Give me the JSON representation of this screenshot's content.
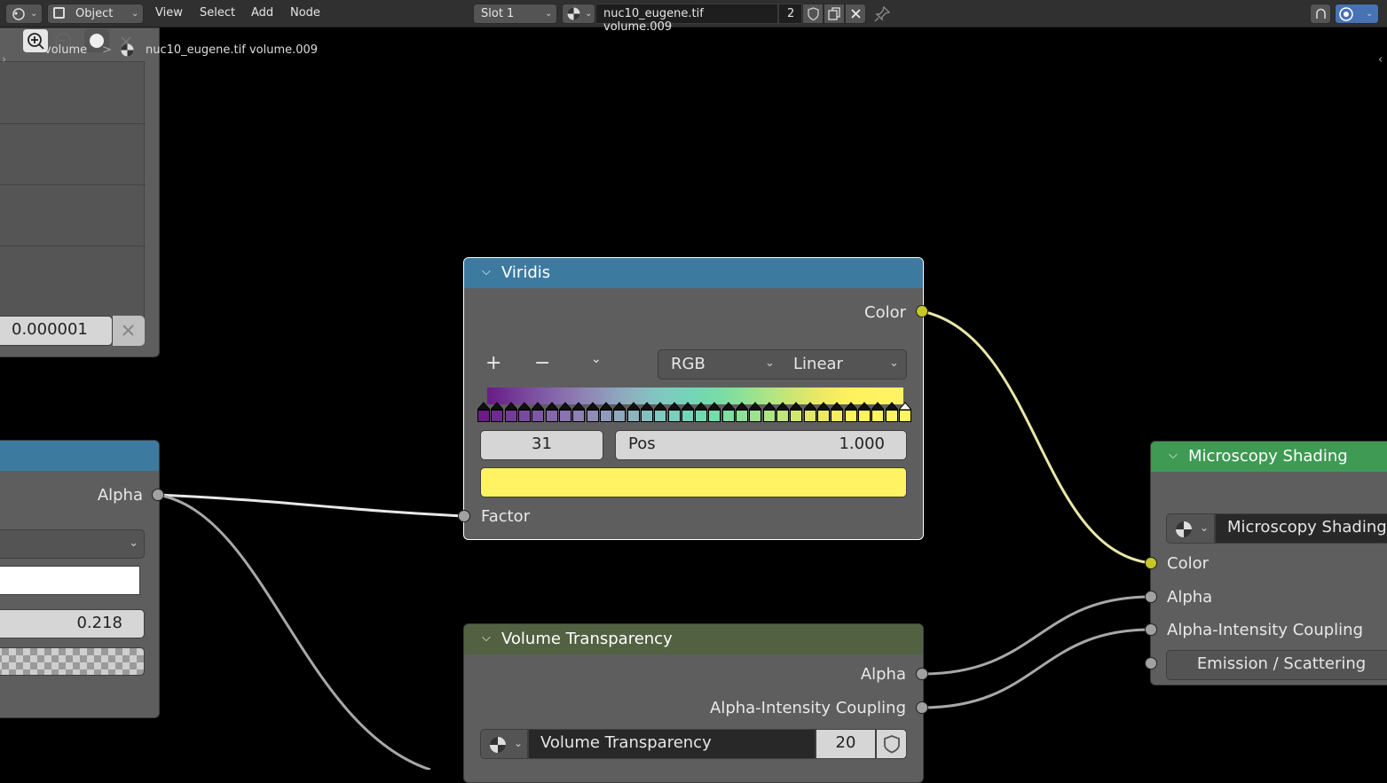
{
  "header": {
    "mode": "Object",
    "menus": [
      "View",
      "Select",
      "Add",
      "Node"
    ],
    "slot": "Slot 1",
    "material_name": "nuc10_eugene.tif volume.009",
    "user_count": "2"
  },
  "breadcrumb": {
    "object": "volume",
    "separator": ">",
    "material": "nuc10_eugene.tif volume.009"
  },
  "left_top_node": {
    "value": "0.000001"
  },
  "left_mid_node": {
    "alpha_label": "Alpha",
    "value": "0.218"
  },
  "viridis": {
    "title": "Viridis",
    "color_output": "Color",
    "add_symbol": "+",
    "remove_symbol": "−",
    "color_mode": "RGB",
    "interpolation": "Linear",
    "stop_index": "31",
    "pos_label": "Pos",
    "pos_value": "1.000",
    "stop_color": "#fff263",
    "factor_label": "Factor",
    "ramp_colors": [
      "#6a1b86",
      "#6e2a8f",
      "#733b97",
      "#7a4a9e",
      "#7e58a4",
      "#8466aa",
      "#8a73b0",
      "#8f80b4",
      "#8f8db8",
      "#8f9bbc",
      "#8ea9be",
      "#8cb4bf",
      "#85bfc0",
      "#7fc9c0",
      "#79cfbd",
      "#74d4b8",
      "#73d8b1",
      "#77dca9",
      "#80dea0",
      "#8de197",
      "#9de28d",
      "#aee584",
      "#bfe67a",
      "#d0e671",
      "#e0e769",
      "#eee964",
      "#f6ed60",
      "#fef15e",
      "#fff25f",
      "#fff263",
      "#fff263",
      "#fff466"
    ]
  },
  "volume_transparency": {
    "title": "Volume Transparency",
    "alpha_output": "Alpha",
    "coupling_output": "Alpha-Intensity Coupling",
    "group_name": "Volume Transparency",
    "users": "20"
  },
  "microscopy_shading": {
    "title": "Microscopy Shading",
    "group_name": "Microscopy Shading",
    "color_input": "Color",
    "alpha_input": "Alpha",
    "coupling_input": "Alpha-Intensity Coupling",
    "mode_button": "Emission / Scattering"
  }
}
